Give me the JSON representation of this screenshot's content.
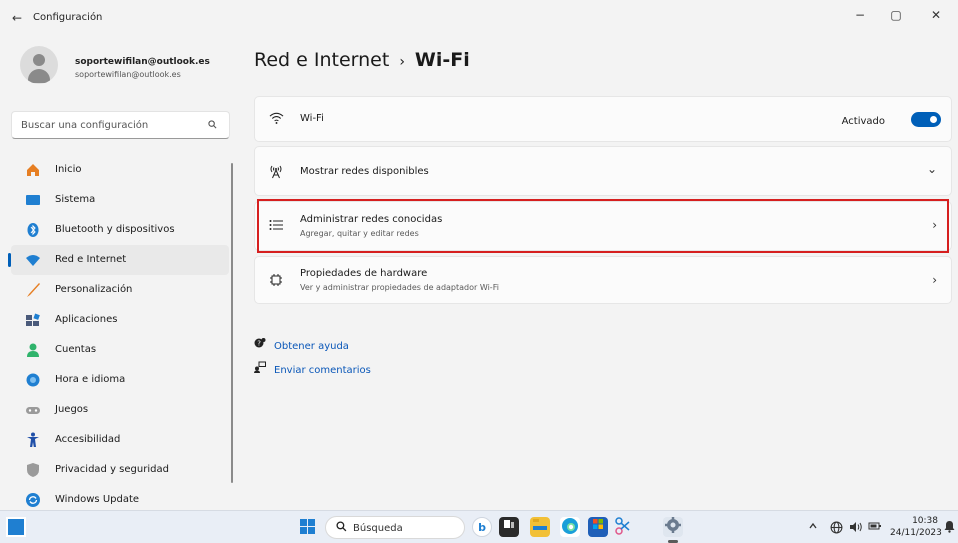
{
  "window": {
    "title": "Configuración",
    "back": "←",
    "controls": {
      "minimize": "−",
      "restore": "▢",
      "close": "✕"
    }
  },
  "user": {
    "name": "soportewifilan@outlook.es",
    "email": "soportewifilan@outlook.es"
  },
  "search": {
    "placeholder": "Buscar una configuración",
    "icon": "search-icon"
  },
  "sidebar": {
    "items": [
      {
        "label": "Inicio",
        "icon": "home-icon",
        "color": "#e67e22"
      },
      {
        "label": "Sistema",
        "icon": "system-icon",
        "color": "#1f7fd1"
      },
      {
        "label": "Bluetooth y dispositivos",
        "icon": "bluetooth-icon",
        "color": "#1f7fd1"
      },
      {
        "label": "Red e Internet",
        "icon": "wifi-icon",
        "color": "#1f7fd1",
        "selected": true
      },
      {
        "label": "Personalización",
        "icon": "brush-icon",
        "color": "#e67e22"
      },
      {
        "label": "Aplicaciones",
        "icon": "apps-icon",
        "color": "#4a5a7a"
      },
      {
        "label": "Cuentas",
        "icon": "account-icon",
        "color": "#2fb36b"
      },
      {
        "label": "Hora e idioma",
        "icon": "time-language-icon",
        "color": "#1f7fd1"
      },
      {
        "label": "Juegos",
        "icon": "gamepad-icon",
        "color": "#8a8a8a"
      },
      {
        "label": "Accesibilidad",
        "icon": "accessibility-icon",
        "color": "#1f4fa8"
      },
      {
        "label": "Privacidad y seguridad",
        "icon": "shield-icon",
        "color": "#8a8a8a"
      },
      {
        "label": "Windows Update",
        "icon": "update-icon",
        "color": "#1f7fd1"
      }
    ]
  },
  "breadcrumb": {
    "parent": "Red e Internet",
    "separator": "›",
    "current": "Wi-Fi"
  },
  "cards": {
    "wifi": {
      "title": "Wi-Fi",
      "state_label": "Activado",
      "on": true,
      "icon": "wifi-icon"
    },
    "available": {
      "title": "Mostrar redes disponibles",
      "icon": "antenna-icon",
      "chevron": "⌄"
    },
    "known": {
      "title": "Administrar redes conocidas",
      "subtitle": "Agregar, quitar y editar redes",
      "icon": "list-icon",
      "chevron": "›"
    },
    "hardware": {
      "title": "Propiedades de hardware",
      "subtitle": "Ver y administrar propiedades de adaptador Wi-Fi",
      "icon": "chip-icon",
      "chevron": "›"
    }
  },
  "links": {
    "help": "Obtener ayuda",
    "feedback": "Enviar comentarios"
  },
  "taskbar": {
    "search_label": "Búsqueda",
    "time": "10:38",
    "date": "24/11/2023"
  },
  "colors": {
    "accent": "#005fb8",
    "highlight": "#d61f1f"
  }
}
